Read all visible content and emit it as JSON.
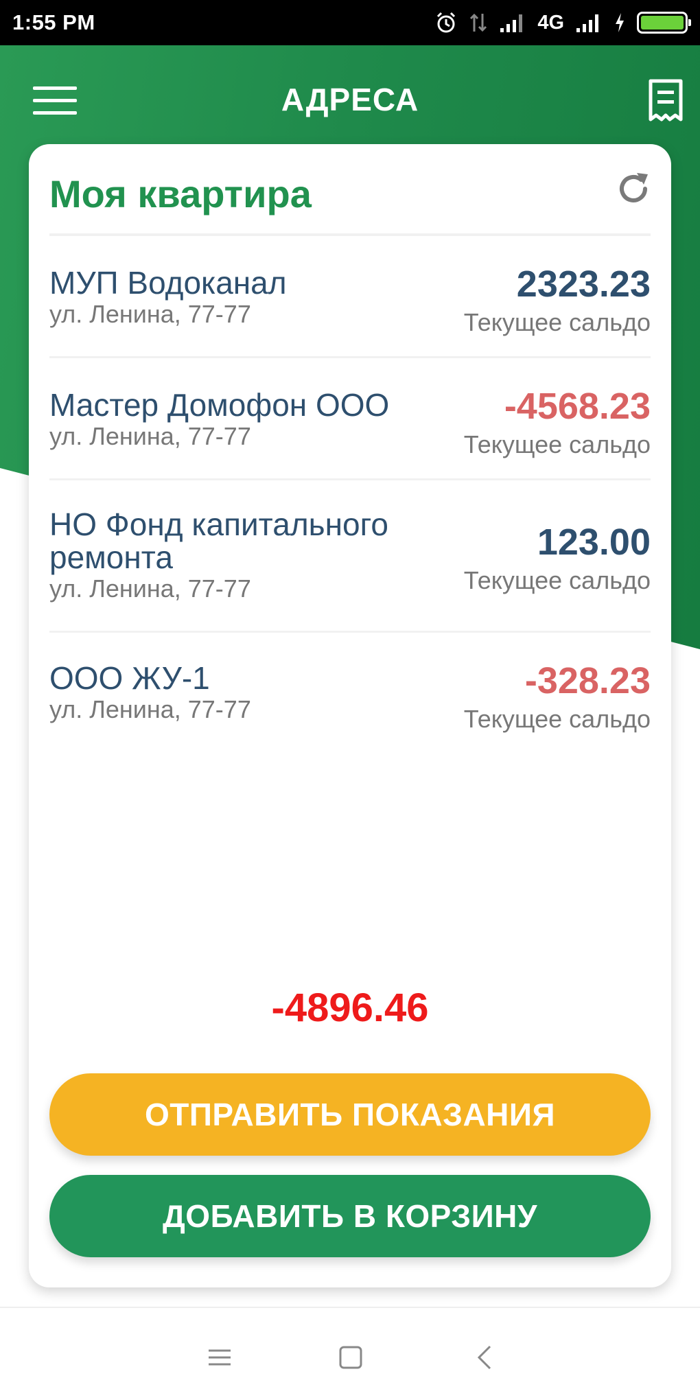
{
  "status_bar": {
    "time": "1:55 PM",
    "network": "4G"
  },
  "app_bar": {
    "title": "АДРЕСА"
  },
  "card": {
    "title": "Моя квартира",
    "rows": [
      {
        "name": "МУП Водоканал",
        "address": "ул. Ленина, 77-77",
        "balance": "2323.23",
        "balance_label": "Текущее сальдо"
      },
      {
        "name": "Мастер Домофон ООО",
        "address": "ул. Ленина, 77-77",
        "balance": "-4568.23",
        "balance_label": "Текущее сальдо"
      },
      {
        "name": "НО Фонд капитального ремонта",
        "address": "ул. Ленина, 77-77",
        "balance": "123.00",
        "balance_label": "Текущее сальдо"
      },
      {
        "name": "ООО ЖУ-1",
        "address": "ул. Ленина, 77-77",
        "balance": "-328.23",
        "balance_label": "Текущее сальдо"
      }
    ],
    "total": "-4896.46"
  },
  "buttons": {
    "send_readings": "ОТПРАВИТЬ ПОКАЗАНИЯ",
    "add_to_cart": "ДОБАВИТЬ В КОРЗИНУ"
  },
  "colors": {
    "brand_green": "#21924f",
    "header_green": "#1f8a4b",
    "accent_yellow": "#f5b323",
    "positive_balance": "#2e4f6e",
    "negative_balance": "#d96363",
    "total_negative": "#ee1b1b"
  },
  "icons": {
    "menu": "hamburger-menu-icon",
    "receipt": "receipt-icon",
    "refresh": "refresh-icon",
    "nav_recent": "recent-apps-icon",
    "nav_home": "home-icon",
    "nav_back": "back-icon"
  }
}
